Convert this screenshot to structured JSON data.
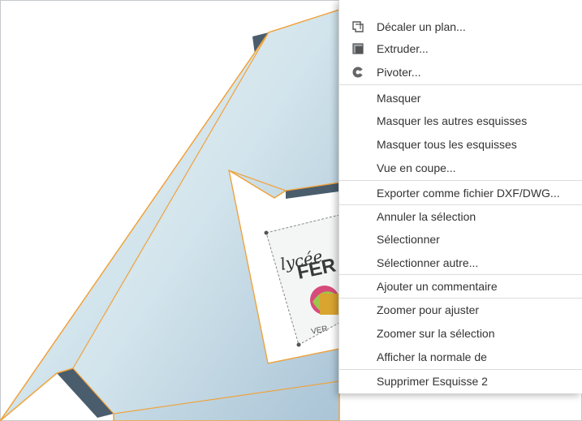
{
  "menu": {
    "items": [
      {
        "label": "Décaler un plan...",
        "icon": "offset-plane-icon"
      },
      {
        "label": "Extruder...",
        "icon": "extrude-icon"
      },
      {
        "label": "Pivoter...",
        "icon": "revolve-icon"
      },
      {
        "label": "Masquer"
      },
      {
        "label": "Masquer les autres esquisses"
      },
      {
        "label": "Masquer tous les esquisses"
      },
      {
        "label": "Vue en coupe..."
      },
      {
        "label": "Exporter comme fichier DXF/DWG..."
      },
      {
        "label": "Annuler la sélection"
      },
      {
        "label": "Sélectionner"
      },
      {
        "label": "Sélectionner autre..."
      },
      {
        "label": "Ajouter un commentaire"
      },
      {
        "label": "Zoomer pour ajuster"
      },
      {
        "label": "Zoomer sur la sélection"
      },
      {
        "label": "Afficher la normale de"
      },
      {
        "label": "Supprimer Esquisse 2"
      }
    ]
  },
  "colors": {
    "part_face": "#cfe0ea",
    "part_side": "#4d6070",
    "selection_outline": "#f0a23a"
  }
}
